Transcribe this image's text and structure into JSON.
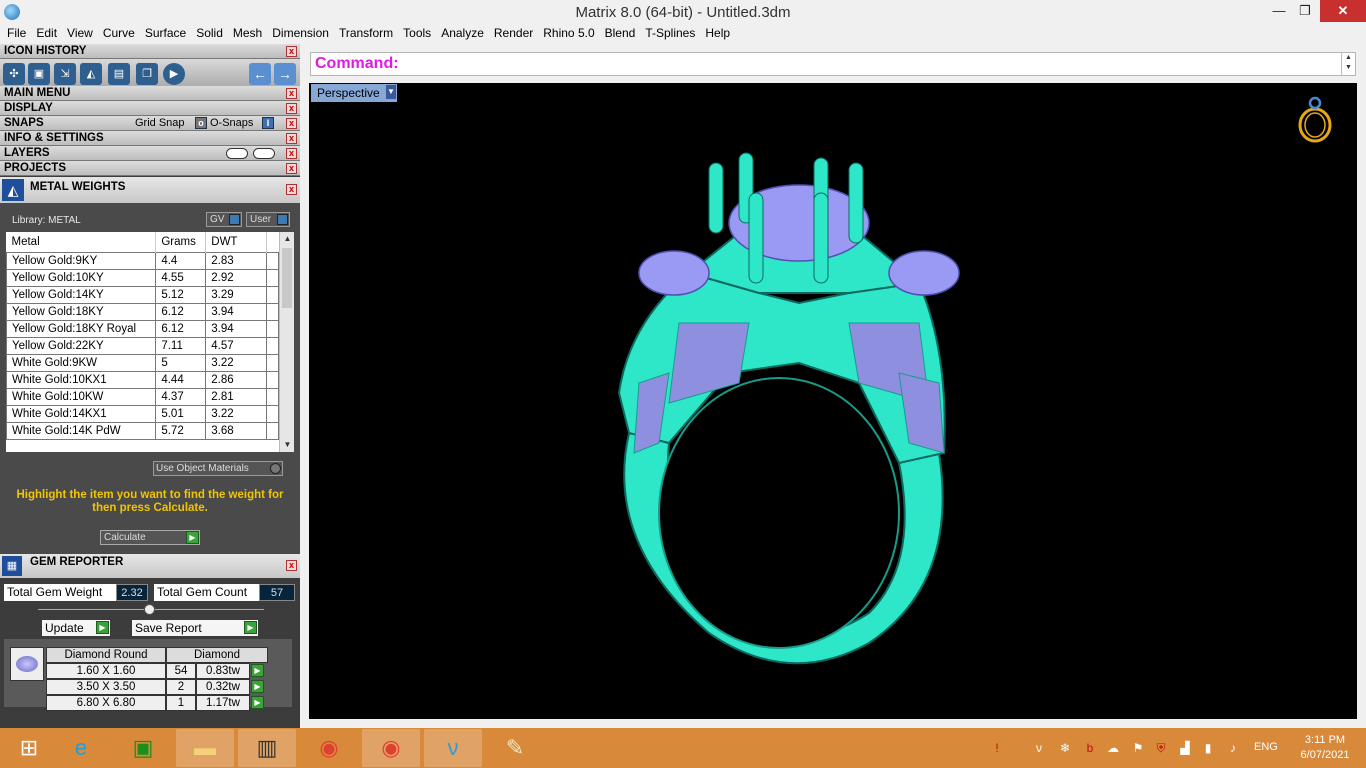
{
  "window": {
    "title": "Matrix 8.0 (64-bit) - Untitled.3dm",
    "minimize": "—",
    "maximize": "❐",
    "close": "✕"
  },
  "menu": [
    "File",
    "Edit",
    "View",
    "Curve",
    "Surface",
    "Solid",
    "Mesh",
    "Dimension",
    "Transform",
    "Tools",
    "Analyze",
    "Render",
    "Rhino 5.0",
    "Blend",
    "T-Splines",
    "Help"
  ],
  "left_panel": {
    "icon_history": "ICON HISTORY",
    "main_menu": "MAIN MENU",
    "display": "DISPLAY",
    "snaps": "SNAPS",
    "grid_snap": "Grid Snap",
    "o_snaps": "O-Snaps",
    "info_settings": "INFO & SETTINGS",
    "layers": "LAYERS",
    "projects": "PROJECTS",
    "metal_weights": {
      "title": "METAL WEIGHTS",
      "library": "Library: METAL",
      "gv": "GV",
      "user": "User",
      "columns": [
        "Metal",
        "Grams",
        "DWT"
      ],
      "rows": [
        [
          "Yellow Gold:9KY",
          "4.4",
          "2.83"
        ],
        [
          "Yellow Gold:10KY",
          "4.55",
          "2.92"
        ],
        [
          "Yellow Gold:14KY",
          "5.12",
          "3.29"
        ],
        [
          "Yellow Gold:18KY",
          "6.12",
          "3.94"
        ],
        [
          "Yellow Gold:18KY Royal",
          "6.12",
          "3.94"
        ],
        [
          "Yellow Gold:22KY",
          "7.11",
          "4.57"
        ],
        [
          "White Gold:9KW",
          "5",
          "3.22"
        ],
        [
          "White Gold:10KX1",
          "4.44",
          "2.86"
        ],
        [
          "White Gold:10KW",
          "4.37",
          "2.81"
        ],
        [
          "White Gold:14KX1",
          "5.01",
          "3.22"
        ],
        [
          "White Gold:14K PdW",
          "5.72",
          "3.68"
        ]
      ],
      "use_object_materials": "Use Object Materials",
      "hint": "Highlight the item you want to find the weight for then press Calculate.",
      "calculate": "Calculate"
    },
    "gem_reporter": {
      "title": "GEM REPORTER",
      "total_weight_label": "Total Gem Weight",
      "total_weight": "2.32",
      "total_count_label": "Total Gem Count",
      "total_count": "57",
      "update": "Update",
      "save_report": "Save Report",
      "head_shape": "Diamond Round",
      "head_type": "Diamond",
      "rows": [
        [
          "1.60 X 1.60",
          "54",
          "0.83tw"
        ],
        [
          "3.50 X 3.50",
          "2",
          "0.32tw"
        ],
        [
          "6.80 X 6.80",
          "1",
          "1.17tw"
        ]
      ]
    }
  },
  "command": {
    "label": "Command:",
    "value": ""
  },
  "viewport": {
    "name": "Perspective"
  },
  "taskbar": {
    "language": "ENG",
    "time": "3:11 PM",
    "date": "6/07/2021"
  },
  "colors": {
    "ring_metal": "#2ee6c8",
    "ring_wire": "#1a9b89",
    "gem": "#9a9af5",
    "command_label": "#e119e6",
    "hint_text": "#f2c500",
    "taskbar": "#d9893a"
  },
  "icons": {
    "taskbar_apps": [
      "start-icon",
      "ie-icon",
      "store-icon",
      "file-explorer-icon",
      "matrix-icon",
      "chrome-icon",
      "chrome-icon",
      "vpn-icon",
      "paint-icon"
    ]
  }
}
